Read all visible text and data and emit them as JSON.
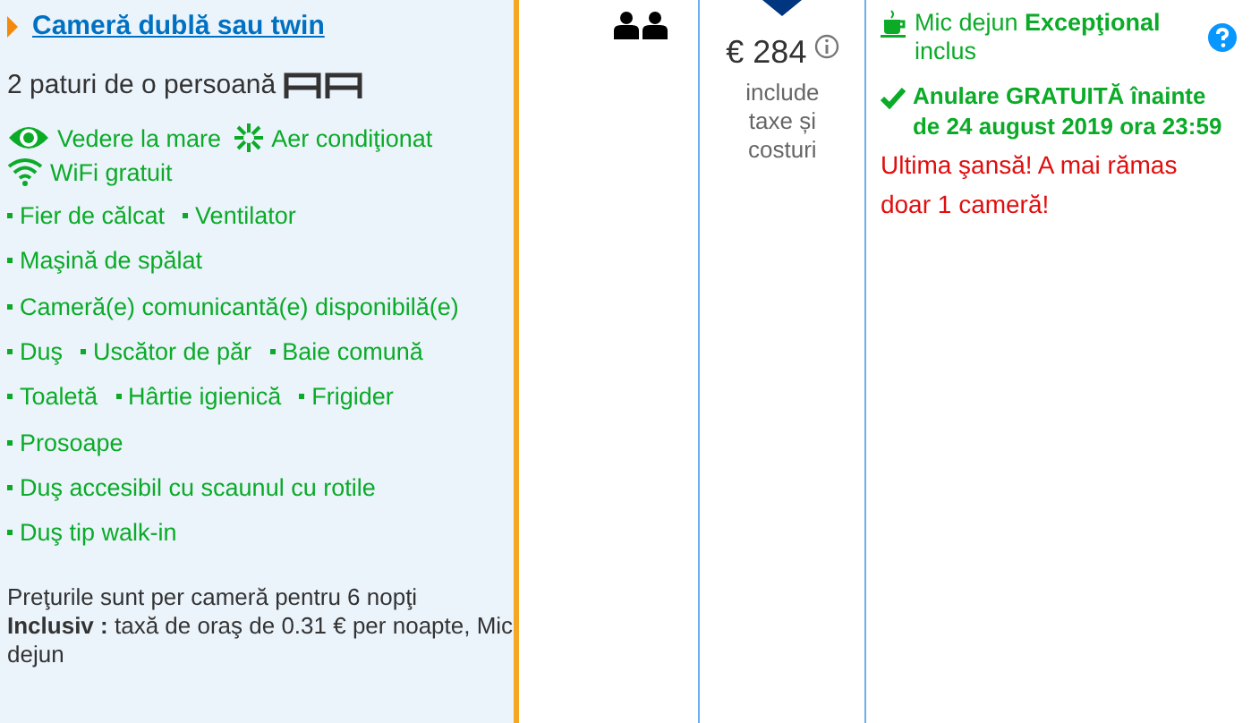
{
  "room": {
    "name": "Cameră dublă sau twin",
    "beds": "2 paturi de o persoană",
    "highlights": [
      {
        "kind": "eye",
        "label": "Vedere la mare"
      },
      {
        "kind": "snowflake",
        "label": "Aer condiţionat"
      },
      {
        "kind": "wifi",
        "label": "WiFi gratuit"
      }
    ],
    "facilities": [
      [
        "Fier de călcat",
        "Ventilator"
      ],
      [
        "Maşină de spălat"
      ],
      [
        "Cameră(e) comunicantă(e) disponibilă(e)"
      ],
      [
        "Duş",
        "Uscător de păr",
        "Baie comună"
      ],
      [
        "Toaletă",
        "Hârtie igienică",
        "Frigider"
      ],
      [
        "Prosoape"
      ],
      [
        "Duş accesibil cu scaunul cu rotile"
      ],
      [
        "Duş tip walk-in"
      ]
    ],
    "price_note": "Preţurile sunt per cameră pentru 6 nopţi",
    "included": "**Inclusiv :** taxă de oraş de 0.31 € per noapte, Mic dejun"
  },
  "price": {
    "amount": "€ 284",
    "note": "include taxe și costuri"
  },
  "conditions": {
    "breakfast": "Mic dejun **Excepţional** inclus",
    "cancellation": "Anulare GRATUITĂ înainte de 24 august 2019 ora 23:59",
    "urgency": "Ultima şansă! A mai rămas doar 1 cameră!"
  }
}
